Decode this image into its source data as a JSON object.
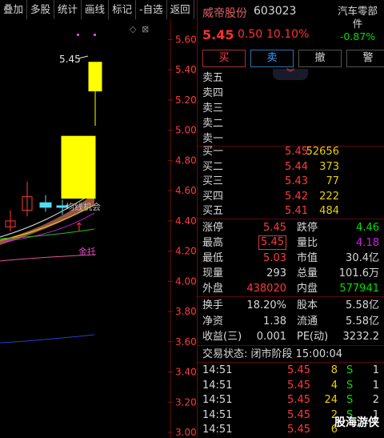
{
  "toolbar": [
    "叠加",
    "多股",
    "统计",
    "画线",
    "标记",
    "-自选",
    "返回"
  ],
  "chart_data": {
    "type": "candlestick",
    "y_ticks": [
      "5.60",
      "5.40",
      "5.20",
      "5.00",
      "4.80",
      "4.60",
      "4.40",
      "4.20",
      "4.00",
      "3.80",
      "3.60",
      "3.40",
      "3.20",
      "3.00"
    ],
    "ylim": [
      3.0,
      5.65
    ],
    "annotations": {
      "high_label": "5.45",
      "golden_cross": "均线机会",
      "support": "金托"
    },
    "candles": [
      {
        "open": 4.4,
        "high": 4.47,
        "low": 4.33,
        "close": 4.36,
        "color": "red-hollow"
      },
      {
        "open": 4.47,
        "high": 4.66,
        "low": 4.43,
        "close": 4.56,
        "color": "red-hollow"
      },
      {
        "open": 4.52,
        "high": 4.57,
        "low": 4.46,
        "close": 4.49,
        "color": "cyan"
      },
      {
        "open": 4.5,
        "high": 4.54,
        "low": 4.44,
        "close": 4.49,
        "color": "cyan"
      },
      {
        "open": 4.55,
        "high": 4.96,
        "low": 4.55,
        "close": 4.96,
        "color": "yellow"
      },
      {
        "open": 5.26,
        "high": 5.45,
        "low": 5.03,
        "close": 5.45,
        "color": "yellow"
      }
    ]
  },
  "stock": {
    "name": "威帝股份",
    "code": "603023",
    "price": "5.45",
    "change": "0.50",
    "pct": "10.10%"
  },
  "sector": {
    "name": "汽车零部件",
    "pct": "-0.87%"
  },
  "actions": {
    "buy": "买",
    "sell": "卖",
    "cancel": "撤",
    "warn": "警"
  },
  "asks": [
    {
      "label": "卖五",
      "price": "",
      "vol": ""
    },
    {
      "label": "卖四",
      "price": "",
      "vol": ""
    },
    {
      "label": "卖三",
      "price": "",
      "vol": ""
    },
    {
      "label": "卖二",
      "price": "",
      "vol": ""
    },
    {
      "label": "卖一",
      "price": "",
      "vol": ""
    }
  ],
  "bids": [
    {
      "label": "买一",
      "price": "5.45",
      "vol": "52656"
    },
    {
      "label": "买二",
      "price": "5.44",
      "vol": "373"
    },
    {
      "label": "买三",
      "price": "5.43",
      "vol": "77"
    },
    {
      "label": "买四",
      "price": "5.42",
      "vol": "222"
    },
    {
      "label": "买五",
      "price": "5.41",
      "vol": "484"
    }
  ],
  "stats1": [
    {
      "l1": "涨停",
      "v1": "5.45",
      "l2": "跌停",
      "v2": "4.46"
    },
    {
      "l1": "最高",
      "v1": "5.45",
      "l2": "量比",
      "v2": "4.18"
    },
    {
      "l1": "最低",
      "v1": "5.03",
      "l2": "市值",
      "v2": "30.4亿"
    },
    {
      "l1": "现量",
      "v1": "293",
      "l2": "总量",
      "v2": "101.6万"
    },
    {
      "l1": "外盘",
      "v1": "438020",
      "l2": "内盘",
      "v2": "577941"
    }
  ],
  "stats2": [
    {
      "l1": "换手",
      "v1": "18.20%",
      "l2": "股本",
      "v2": "5.58亿"
    },
    {
      "l1": "净资",
      "v1": "1.38",
      "l2": "流通",
      "v2": "5.58亿"
    },
    {
      "l1": "收益(三)",
      "v1": "0.001",
      "l2": "PE(动)",
      "v2": "3232.2"
    }
  ],
  "trade_status": "交易状态: 闭市阶段 15:00:04",
  "ticks": [
    {
      "time": "14:51",
      "price": "5.45",
      "vol": "8",
      "side": "S",
      "n": "1"
    },
    {
      "time": "14:51",
      "price": "5.45",
      "vol": "4",
      "side": "S",
      "n": "1"
    },
    {
      "time": "14:51",
      "price": "5.45",
      "vol": "24",
      "side": "S",
      "n": "2"
    },
    {
      "time": "14:51",
      "price": "5.45",
      "vol": "2",
      "side": "S",
      "n": "1"
    },
    {
      "time": "14:51",
      "price": "5.45",
      "vol": "6",
      "side": "",
      "n": ""
    }
  ],
  "watermark": "股海游侠"
}
